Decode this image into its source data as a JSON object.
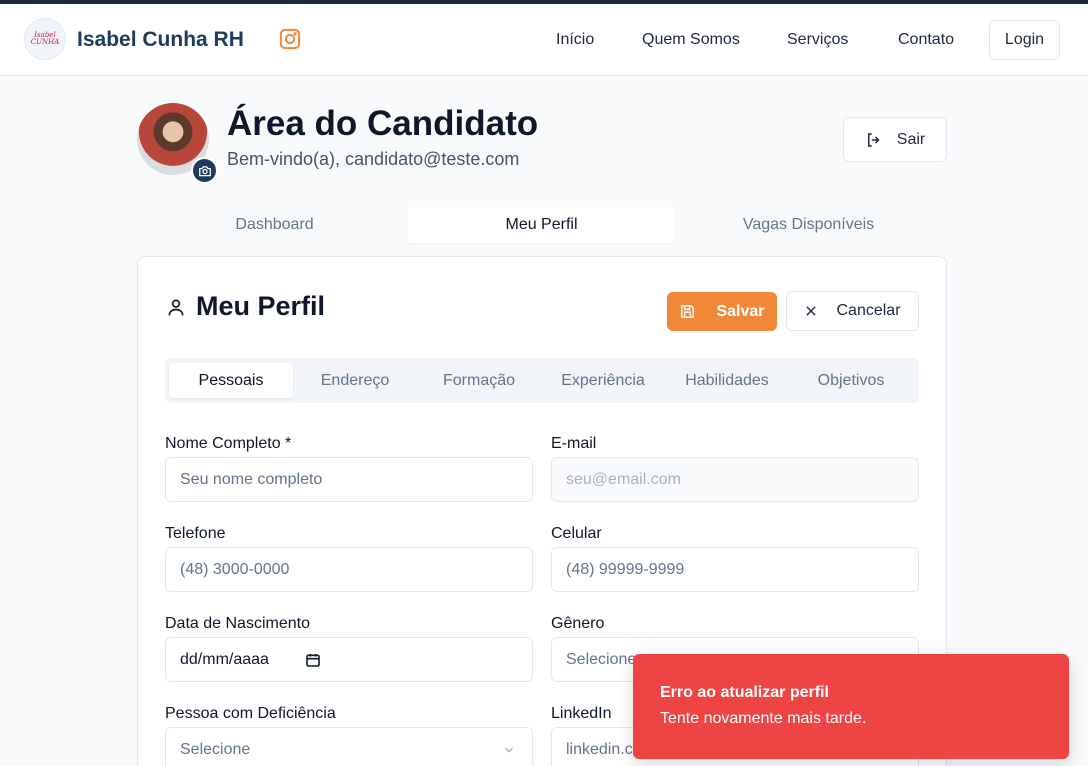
{
  "header": {
    "brand": "Isabel Cunha RH",
    "logo_text": "Isabel CUNHA",
    "nav": [
      "Início",
      "Quem Somos",
      "Serviços",
      "Contato"
    ],
    "login": "Login"
  },
  "profile": {
    "title": "Área do Candidato",
    "welcome": "Bem-vindo(a), candidato@teste.com",
    "logout": "Sair"
  },
  "main_tabs": [
    "Dashboard",
    "Meu Perfil",
    "Vagas Disponíveis"
  ],
  "main_tabs_active": "Meu Perfil",
  "card": {
    "title": "Meu Perfil",
    "save": "Salvar",
    "cancel": "Cancelar",
    "subtabs": [
      "Pessoais",
      "Endereço",
      "Formação",
      "Experiência",
      "Habilidades",
      "Objetivos"
    ],
    "subtabs_active": "Pessoais"
  },
  "form": {
    "nome_label": "Nome Completo *",
    "nome_placeholder": "Seu nome completo",
    "email_label": "E-mail",
    "email_placeholder": "seu@email.com",
    "telefone_label": "Telefone",
    "telefone_placeholder": "(48) 3000-0000",
    "celular_label": "Celular",
    "celular_placeholder": "(48) 99999-9999",
    "nascimento_label": "Data de Nascimento",
    "nascimento_value": "dd/mm/aaaa",
    "genero_label": "Gênero",
    "genero_value": "Selecione",
    "pcd_label": "Pessoa com Deficiência",
    "pcd_value": "Selecione",
    "linkedin_label": "LinkedIn",
    "linkedin_placeholder": "linkedin.com"
  },
  "toast": {
    "title": "Erro ao atualizar perfil",
    "description": "Tente novamente mais tarde."
  },
  "colors": {
    "accent": "#f0883a",
    "brand": "#1e3a5f",
    "error": "#ef4444"
  }
}
